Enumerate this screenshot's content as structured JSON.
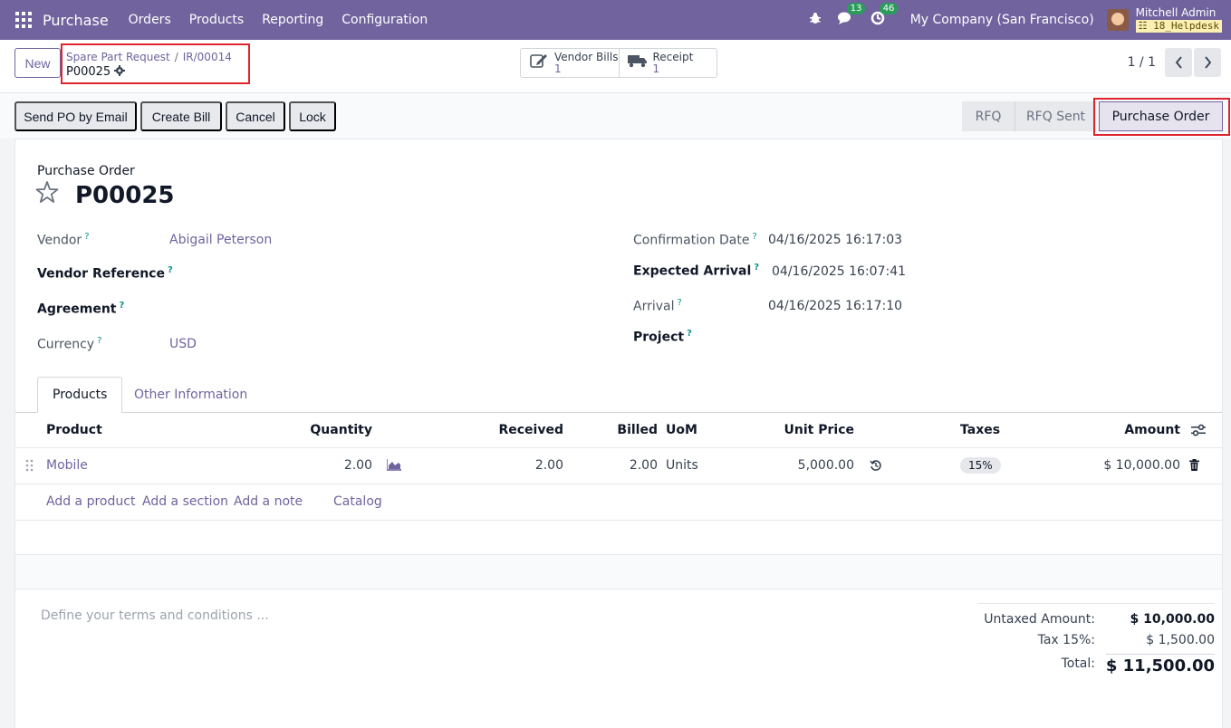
{
  "navbar": {
    "app_name": "Purchase",
    "menu": [
      "Orders",
      "Products",
      "Reporting",
      "Configuration"
    ],
    "messages_count": "13",
    "activities_count": "46",
    "company": "My Company (San Francisco)",
    "user_name": "Mitchell Admin",
    "database": "18_Helpdesk"
  },
  "control_panel": {
    "new_label": "New",
    "breadcrumb": [
      "Spare Part Request",
      "IR/00014"
    ],
    "current_record": "P00025",
    "smart_buttons": [
      {
        "label": "Vendor Bills",
        "value": "1",
        "icon": "edit-icon"
      },
      {
        "label": "Receipt",
        "value": "1",
        "icon": "truck-icon"
      }
    ],
    "pager": "1 / 1"
  },
  "statusbar": {
    "actions": [
      "Send PO by Email",
      "Create Bill",
      "Cancel",
      "Lock"
    ],
    "stages": [
      "RFQ",
      "RFQ Sent",
      "Purchase Order"
    ],
    "active_stage": "Purchase Order"
  },
  "form": {
    "doc_type": "Purchase Order",
    "name": "P00025",
    "vendor_label": "Vendor",
    "vendor": "Abigail Peterson",
    "vendor_ref_label": "Vendor Reference",
    "agreement_label": "Agreement",
    "currency_label": "Currency",
    "currency": "USD",
    "confirmation_date_label": "Confirmation Date",
    "confirmation_date": "04/16/2025 16:17:03",
    "expected_arrival_label": "Expected Arrival",
    "expected_arrival": "04/16/2025 16:07:41",
    "arrival_label": "Arrival",
    "arrival": "04/16/2025 16:17:10",
    "project_label": "Project"
  },
  "tabs": [
    "Products",
    "Other Information"
  ],
  "table": {
    "headers": [
      "Product",
      "Quantity",
      "Received",
      "Billed",
      "UoM",
      "Unit Price",
      "Taxes",
      "Amount"
    ],
    "rows": [
      {
        "product": "Mobile",
        "quantity": "2.00",
        "received": "2.00",
        "billed": "2.00",
        "uom": "Units",
        "unit_price": "5,000.00",
        "taxes": "15%",
        "amount": "$ 10,000.00"
      }
    ],
    "add_links": [
      "Add a product",
      "Add a section",
      "Add a note",
      "Catalog"
    ]
  },
  "terms_placeholder": "Define your terms and conditions ...",
  "totals": {
    "untaxed_label": "Untaxed Amount:",
    "untaxed": "$ 10,000.00",
    "tax_label": "Tax 15%:",
    "tax": "$ 1,500.00",
    "total_label": "Total:",
    "total": "$ 11,500.00"
  },
  "colors": {
    "brand": "#71639e",
    "highlight": "#e0242d"
  }
}
